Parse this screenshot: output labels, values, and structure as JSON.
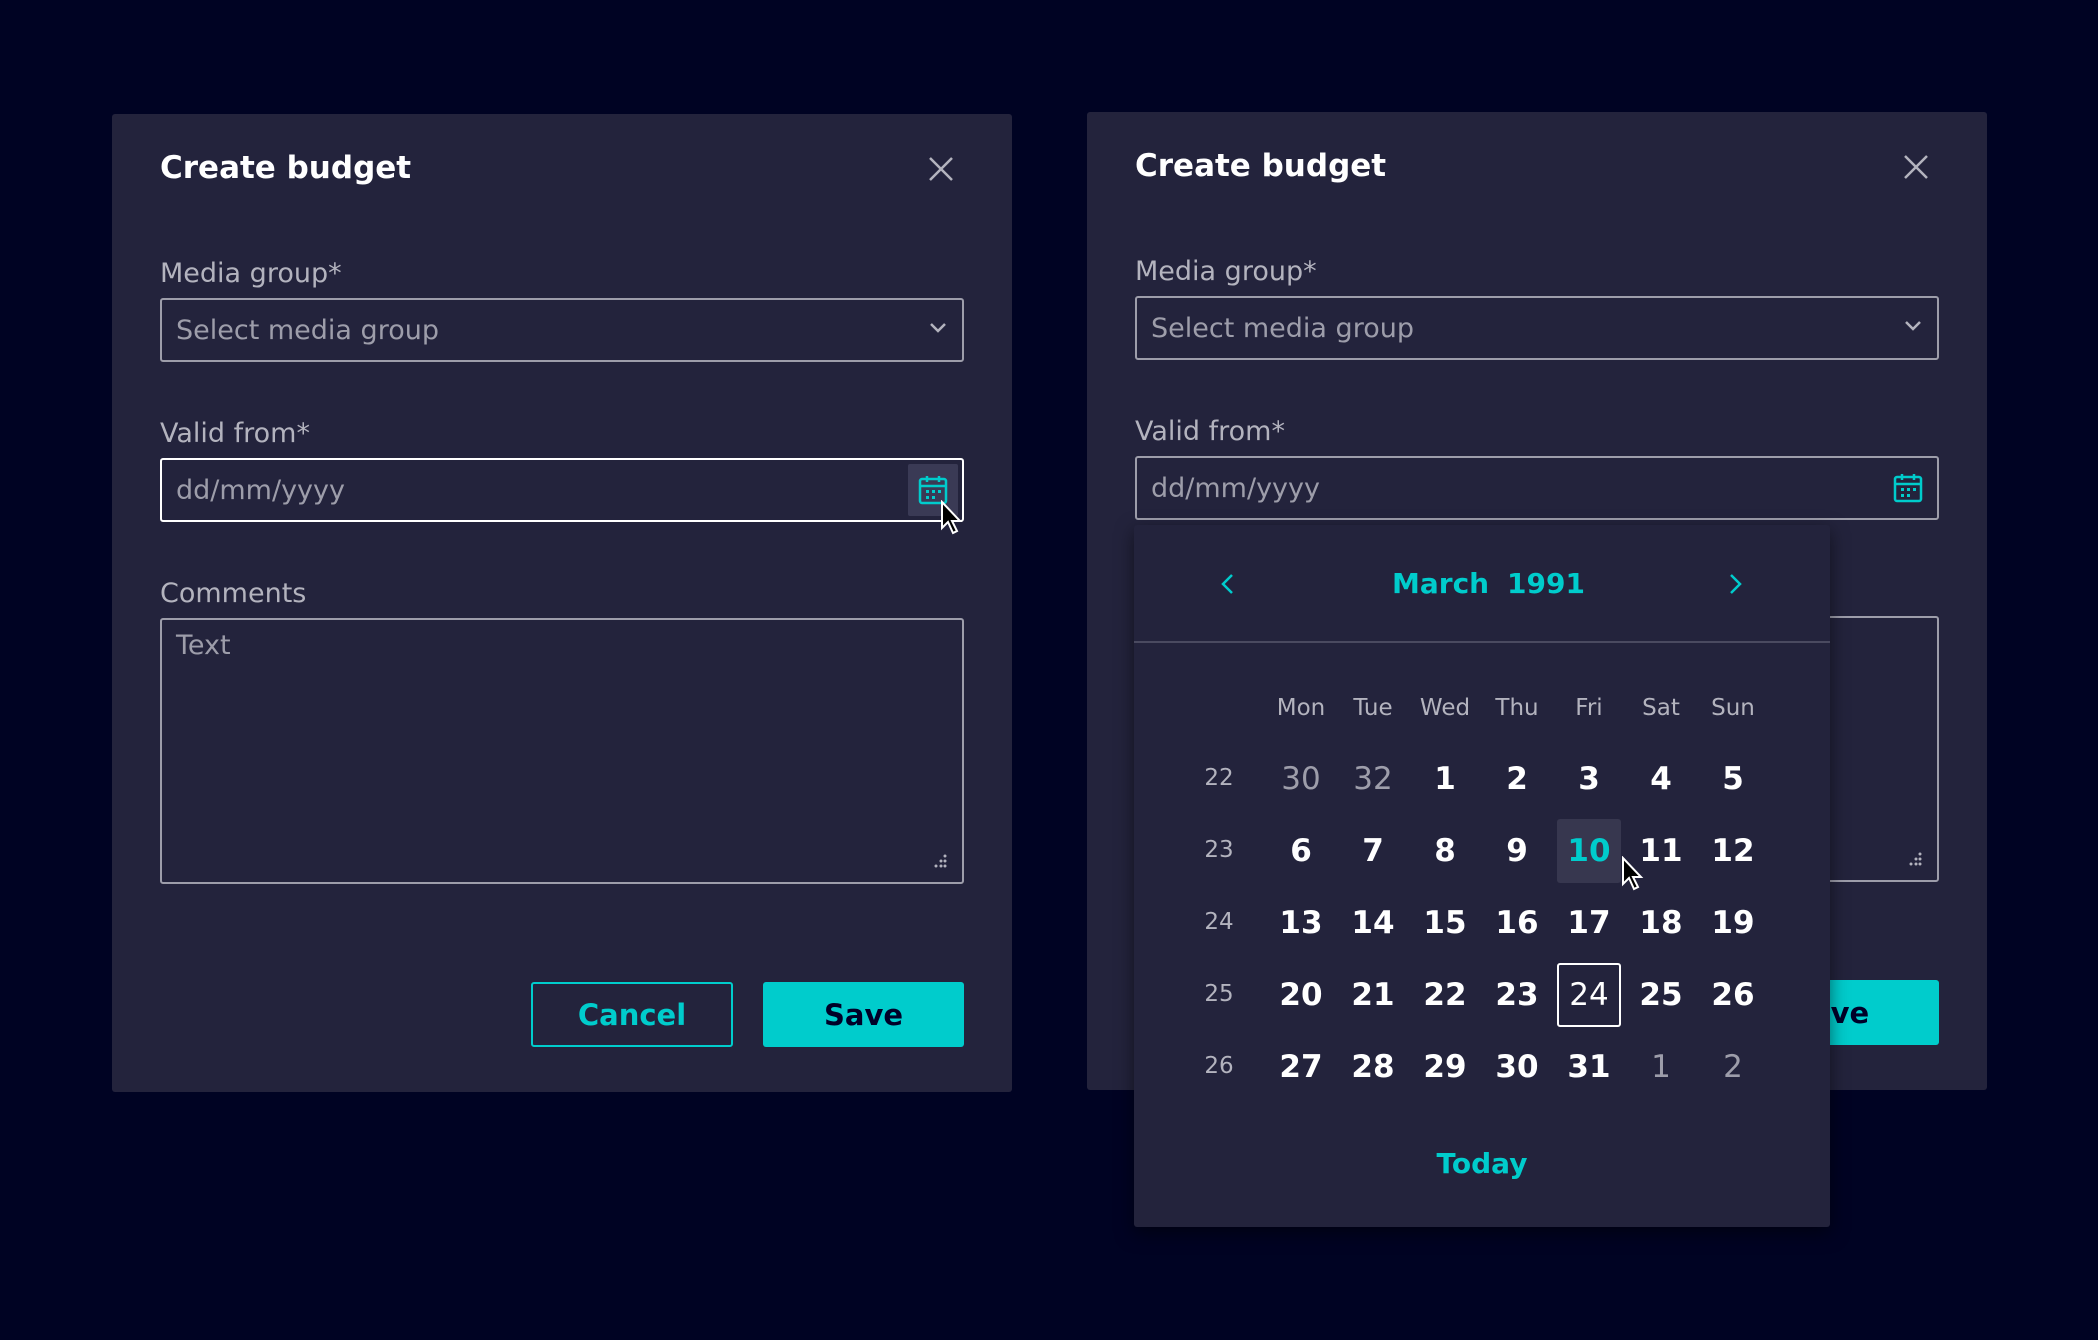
{
  "dialog_left": {
    "title": "Create budget",
    "media_group": {
      "label": "Media group*",
      "placeholder": "Select media group"
    },
    "valid_from": {
      "label": "Valid from*",
      "placeholder": "dd/mm/yyyy"
    },
    "comments": {
      "label": "Comments",
      "placeholder": "Text"
    },
    "cancel_label": "Cancel",
    "save_label": "Save"
  },
  "dialog_right": {
    "title": "Create budget",
    "media_group": {
      "label": "Media group*",
      "placeholder": "Select media group"
    },
    "valid_from": {
      "label": "Valid from*",
      "placeholder": "dd/mm/yyyy"
    },
    "save_label_partial": "ave"
  },
  "calendar": {
    "month": "March",
    "year": "1991",
    "weekdays": [
      "Mon",
      "Tue",
      "Wed",
      "Thu",
      "Fri",
      "Sat",
      "Sun"
    ],
    "weeks": [
      {
        "number": "22",
        "days": [
          {
            "label": "30",
            "other": true
          },
          {
            "label": "32",
            "other": true
          },
          {
            "label": "1"
          },
          {
            "label": "2"
          },
          {
            "label": "3"
          },
          {
            "label": "4"
          },
          {
            "label": "5"
          }
        ]
      },
      {
        "number": "23",
        "days": [
          {
            "label": "6"
          },
          {
            "label": "7"
          },
          {
            "label": "8"
          },
          {
            "label": "9"
          },
          {
            "label": "10",
            "hover": true
          },
          {
            "label": "11"
          },
          {
            "label": "12"
          }
        ]
      },
      {
        "number": "24",
        "days": [
          {
            "label": "13"
          },
          {
            "label": "14"
          },
          {
            "label": "15"
          },
          {
            "label": "16"
          },
          {
            "label": "17"
          },
          {
            "label": "18"
          },
          {
            "label": "19"
          }
        ]
      },
      {
        "number": "25",
        "days": [
          {
            "label": "20"
          },
          {
            "label": "21"
          },
          {
            "label": "22"
          },
          {
            "label": "23"
          },
          {
            "label": "24",
            "today": true
          },
          {
            "label": "25"
          },
          {
            "label": "26"
          }
        ]
      },
      {
        "number": "26",
        "days": [
          {
            "label": "27"
          },
          {
            "label": "28"
          },
          {
            "label": "29"
          },
          {
            "label": "30"
          },
          {
            "label": "31"
          },
          {
            "label": "1",
            "other": true
          },
          {
            "label": "2",
            "other": true
          }
        ]
      }
    ],
    "today_label": "Today"
  },
  "colors": {
    "background": "#000323",
    "dialog": "#23233c",
    "accent": "#00cccc",
    "border": "#9d9daa"
  },
  "icons": [
    "close-icon",
    "chevron-down-icon",
    "calendar-icon",
    "resize-handle-icon",
    "chevron-left-icon",
    "chevron-right-icon",
    "mouse-pointer-icon"
  ]
}
